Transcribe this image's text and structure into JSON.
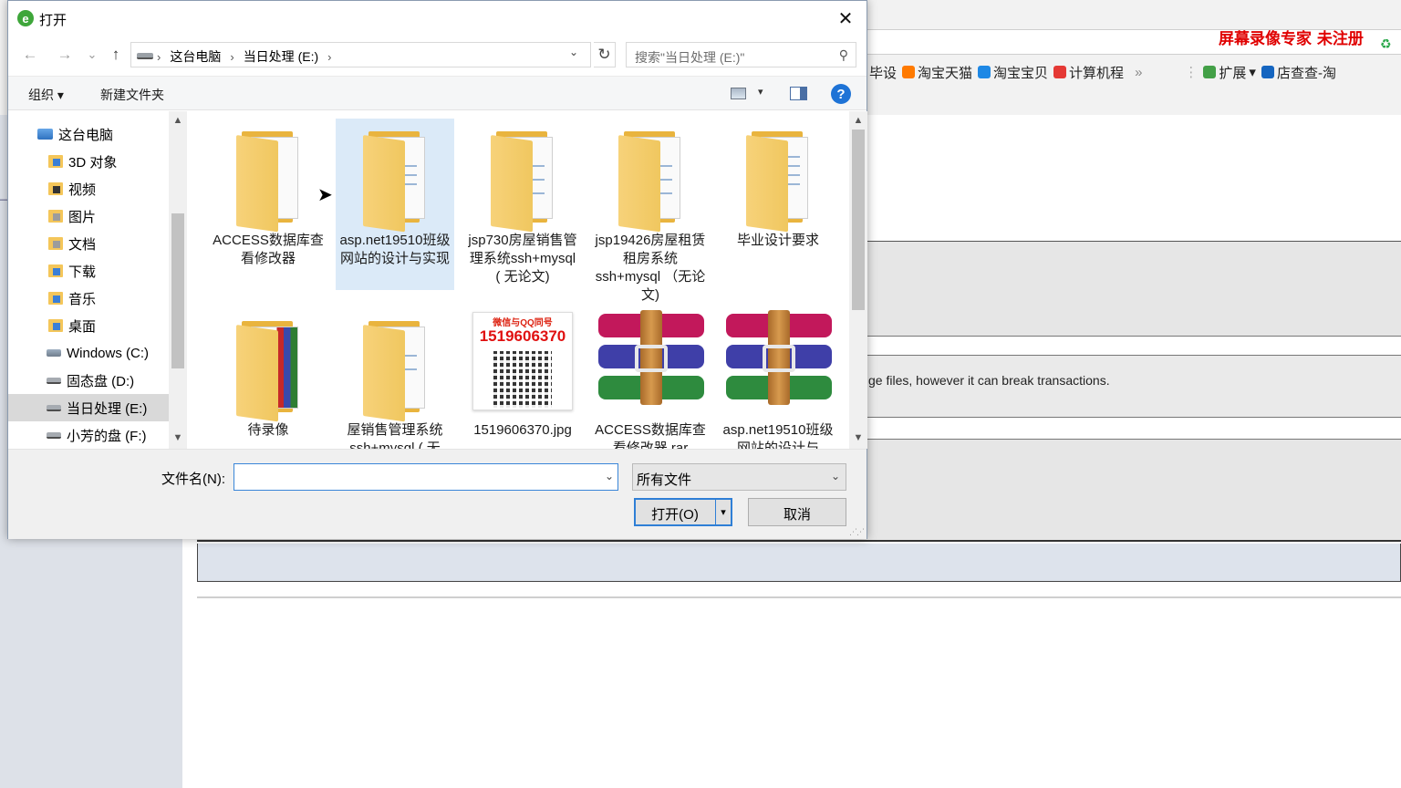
{
  "dialog": {
    "title": "打开",
    "close_glyph": "✕"
  },
  "nav": {
    "back_glyph": "←",
    "forward_glyph": "→",
    "recent_glyph": "⌄",
    "up_glyph": "↑",
    "breadcrumbs": [
      "这台电脑",
      "当日处理 (E:)"
    ],
    "crumb_sep": "›",
    "address_drop_glyph": "⌄",
    "refresh_glyph": "↻",
    "search_placeholder": "搜索\"当日处理 (E:)\"",
    "search_glyph": "⚲"
  },
  "toolbar": {
    "organize": "组织 ▾",
    "new_folder": "新建文件夹",
    "view_drop": "▾",
    "help": "?"
  },
  "tree": {
    "items": [
      {
        "label": "这台电脑",
        "icon": "computer-icon"
      },
      {
        "label": "3D 对象",
        "icon": "3d-objects-icon"
      },
      {
        "label": "视频",
        "icon": "videos-icon"
      },
      {
        "label": "图片",
        "icon": "pictures-icon"
      },
      {
        "label": "文档",
        "icon": "documents-icon"
      },
      {
        "label": "下载",
        "icon": "downloads-icon"
      },
      {
        "label": "音乐",
        "icon": "music-icon"
      },
      {
        "label": "桌面",
        "icon": "desktop-icon"
      },
      {
        "label": "Windows (C:)",
        "icon": "windows-drive-icon"
      },
      {
        "label": "固态盘 (D:)",
        "icon": "drive-icon"
      },
      {
        "label": "当日处理 (E:)",
        "icon": "drive-icon",
        "selected": true
      },
      {
        "label": "小芳的盘 (F:)",
        "icon": "drive-icon"
      }
    ]
  },
  "files": [
    {
      "name": "ACCESS数据库查看修改器",
      "type": "folder"
    },
    {
      "name": "asp.net19510班级网站的设计与实现",
      "type": "folder",
      "selected": true
    },
    {
      "name": "jsp730房屋销售管理系统ssh+mysql ( 无论文)",
      "type": "folder"
    },
    {
      "name": "jsp19426房屋租赁租房系统ssh+mysql （无论文)",
      "type": "folder"
    },
    {
      "name": "毕业设计要求",
      "type": "folder"
    },
    {
      "name": "待录像",
      "type": "folder"
    },
    {
      "name": "屋销售管理系统ssh+mysql ( 无",
      "type": "folder"
    },
    {
      "name": "1519606370.jpg",
      "type": "image",
      "qr_caption": "微信与QQ同号",
      "qr_number": "1519606370"
    },
    {
      "name": "ACCESS数据库查看修改器.rar",
      "type": "rar"
    },
    {
      "name": "asp.net19510班级网站的设计与",
      "type": "rar"
    }
  ],
  "bottom": {
    "filename_label": "文件名(N):",
    "filename_value": "",
    "filetype_value": "所有文件",
    "open_label": "打开(O)",
    "open_split_glyph": "▾",
    "cancel_label": "取消",
    "drop_glyph": "⌄"
  },
  "background": {
    "watermark": "屏幕录像专家  未注册",
    "favorites": [
      "毕设",
      "淘宝天猫",
      "淘宝宝贝",
      "计算机程",
      "»",
      "扩展",
      "店查查-淘"
    ],
    "note": "ge files, however it can break transactions."
  },
  "colors": {
    "accent": "#2f7fd6",
    "selection": "#dbeaf8",
    "folder": "#f0c75f",
    "watermark": "#e00000"
  }
}
